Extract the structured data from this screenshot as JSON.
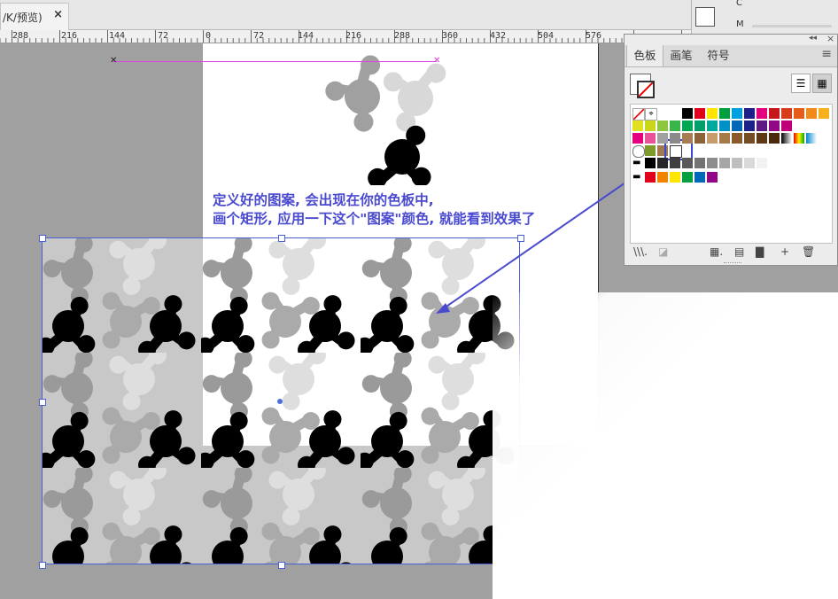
{
  "document_tab": {
    "title": "/K/预览)",
    "close_label": "×"
  },
  "ruler": {
    "labels": [
      "288",
      "216",
      "144",
      "72",
      "0",
      "72",
      "144",
      "216",
      "288",
      "360",
      "432",
      "504",
      "576"
    ]
  },
  "annotation": {
    "line1": "定义好的图案, 会出现在你的色板中,",
    "line2": "画个矩形, 应用一下这个\"图案\"颜色, 就能看到效果了"
  },
  "panel": {
    "tabs": [
      "色板",
      "画笔",
      "符号"
    ],
    "top_labels": {
      "c": "C",
      "m": "M"
    },
    "collapse_label": "◂◂",
    "close_label": "×",
    "menu_label": "≡",
    "list_view_label": "☰",
    "grid_view_label": "▦",
    "footer_buttons": [
      "\\\\\\.",
      "◪",
      "▦.",
      "▤",
      "▇",
      "+",
      "🗑"
    ]
  },
  "swatches": {
    "row1": [
      "#ffffff",
      "#000000",
      "#e0001b",
      "#ffe600",
      "#00a040",
      "#00a0e0",
      "#1d2088",
      "#e4007f",
      "#c8161d",
      "#d83a1a",
      "#e65a1a",
      "#f08a1a",
      "#f5b01a"
    ],
    "row2": [
      "#e0e020",
      "#c8d818",
      "#8cc63f",
      "#39b54a",
      "#00a651",
      "#009e6b",
      "#00a99d",
      "#0092c7",
      "#0068b7",
      "#1d2088",
      "#5f1985",
      "#920783",
      "#c0007a"
    ],
    "row3": [
      "#e4007f",
      "#e85298",
      "#a0a0a0",
      "#8a8a8a",
      "#a67c52",
      "#8c6239",
      "#c69c6d",
      "#a57a48",
      "#8b5a2b",
      "#754c24",
      "#603813",
      "#4a2a0a"
    ],
    "row5": [
      "#000000",
      "#262626",
      "#3f3f3f",
      "#595959",
      "#737373",
      "#8c8c8c",
      "#a6a6a6",
      "#bfbfbf",
      "#d9d9d9",
      "#f2f2f2",
      "#ffffff"
    ],
    "row6": [
      "#e0001b",
      "#f08300",
      "#ffe600",
      "#00a040",
      "#0068b7",
      "#920783"
    ]
  },
  "accent_color": "#4a4ad0"
}
